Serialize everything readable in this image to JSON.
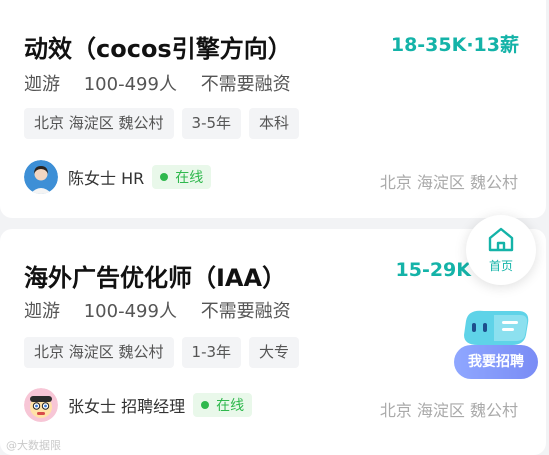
{
  "jobs": [
    {
      "title": "动效（cocos引擎方向）",
      "salary": "18-35K·13薪",
      "company": "迦游",
      "size": "100-499人",
      "funding": "不需要融资",
      "tags": [
        "北京 海淀区 魏公村",
        "3-5年",
        "本科"
      ],
      "recruiter": "陈女士 HR",
      "status": "在线",
      "location": "北京 海淀区 魏公村"
    },
    {
      "title": "海外广告优化师（IAA）",
      "salary": "15-29K",
      "company": "迦游",
      "size": "100-499人",
      "funding": "不需要融资",
      "tags": [
        "北京 海淀区 魏公村",
        "1-3年",
        "大专"
      ],
      "recruiter": "张女士 招聘经理",
      "status": "在线",
      "location": "北京 海淀区 魏公村"
    }
  ],
  "floating": {
    "home_label": "首页",
    "recruit_label": "我要招聘"
  },
  "watermark": "@大数据限",
  "colors": {
    "accent": "#14b3a8",
    "online": "#2fb84d",
    "recruit": "#7a8cf5"
  },
  "icons": [
    "home-icon",
    "chat-bot-icon",
    "avatar-woman",
    "avatar-cartoon"
  ]
}
